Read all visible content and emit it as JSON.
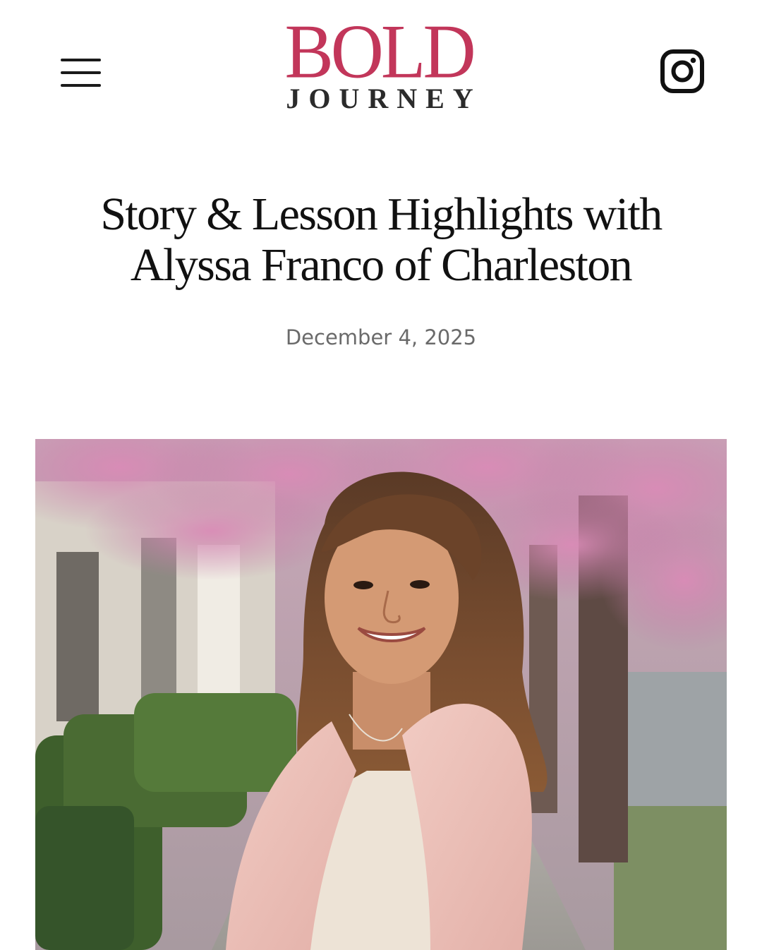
{
  "header": {
    "menu_icon": "hamburger-menu-icon",
    "logo": {
      "top": "BOLD",
      "bottom": "JOURNEY",
      "top_color": "#c2365a",
      "bottom_color": "#2b2b2b"
    },
    "social_icon": "instagram-icon"
  },
  "article": {
    "title_line1": "Story & Lesson Highlights with",
    "title_line2": "Alyssa Franco of Charleston",
    "date": "December 4, 2025",
    "hero_image": "photo-woman-pink-blazer-blossoms"
  }
}
